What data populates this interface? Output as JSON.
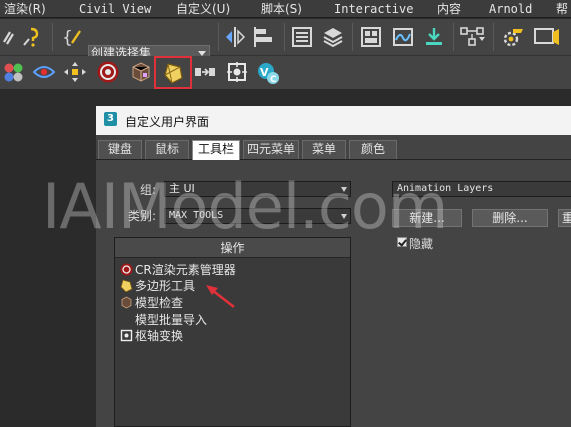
{
  "menubar": {
    "items": [
      "渲染(R)",
      "Civil View",
      "自定义(U)",
      "脚本(S)",
      "Interactive",
      "内容",
      "Arnold",
      "帮"
    ]
  },
  "toolbar": {
    "selection_set_placeholder": "创建选择集"
  },
  "dialog": {
    "title": "自定义用户界面",
    "tabs": [
      "键盘",
      "鼠标",
      "工具栏",
      "四元菜单",
      "菜单",
      "颜色"
    ],
    "active_tab": "工具栏",
    "group_label": "组:",
    "group_value": "主 UI",
    "category_label": "类别:",
    "category_value": "MAX TOOLS",
    "toolbar_select_value": "Animation Layers",
    "new_button": "新建...",
    "delete_button": "删除...",
    "rename_button_partial": "重",
    "hide_label": "隐藏",
    "hide_checked": true,
    "list_header": "操作",
    "actions": [
      {
        "label": "CR渲染元素管理器",
        "icon": "cr-render-icon"
      },
      {
        "label": "多边形工具",
        "icon": "polygon-tool-icon"
      },
      {
        "label": "模型检查",
        "icon": "model-check-icon"
      },
      {
        "label": "模型批量导入",
        "icon": ""
      },
      {
        "label": "枢轴变换",
        "icon": "pivot-transform-icon"
      }
    ]
  },
  "watermark": "IAIModel.com",
  "colors": {
    "highlight": "#e0303a",
    "arrow": "#e0303a",
    "accent": "#1f8fa6"
  }
}
